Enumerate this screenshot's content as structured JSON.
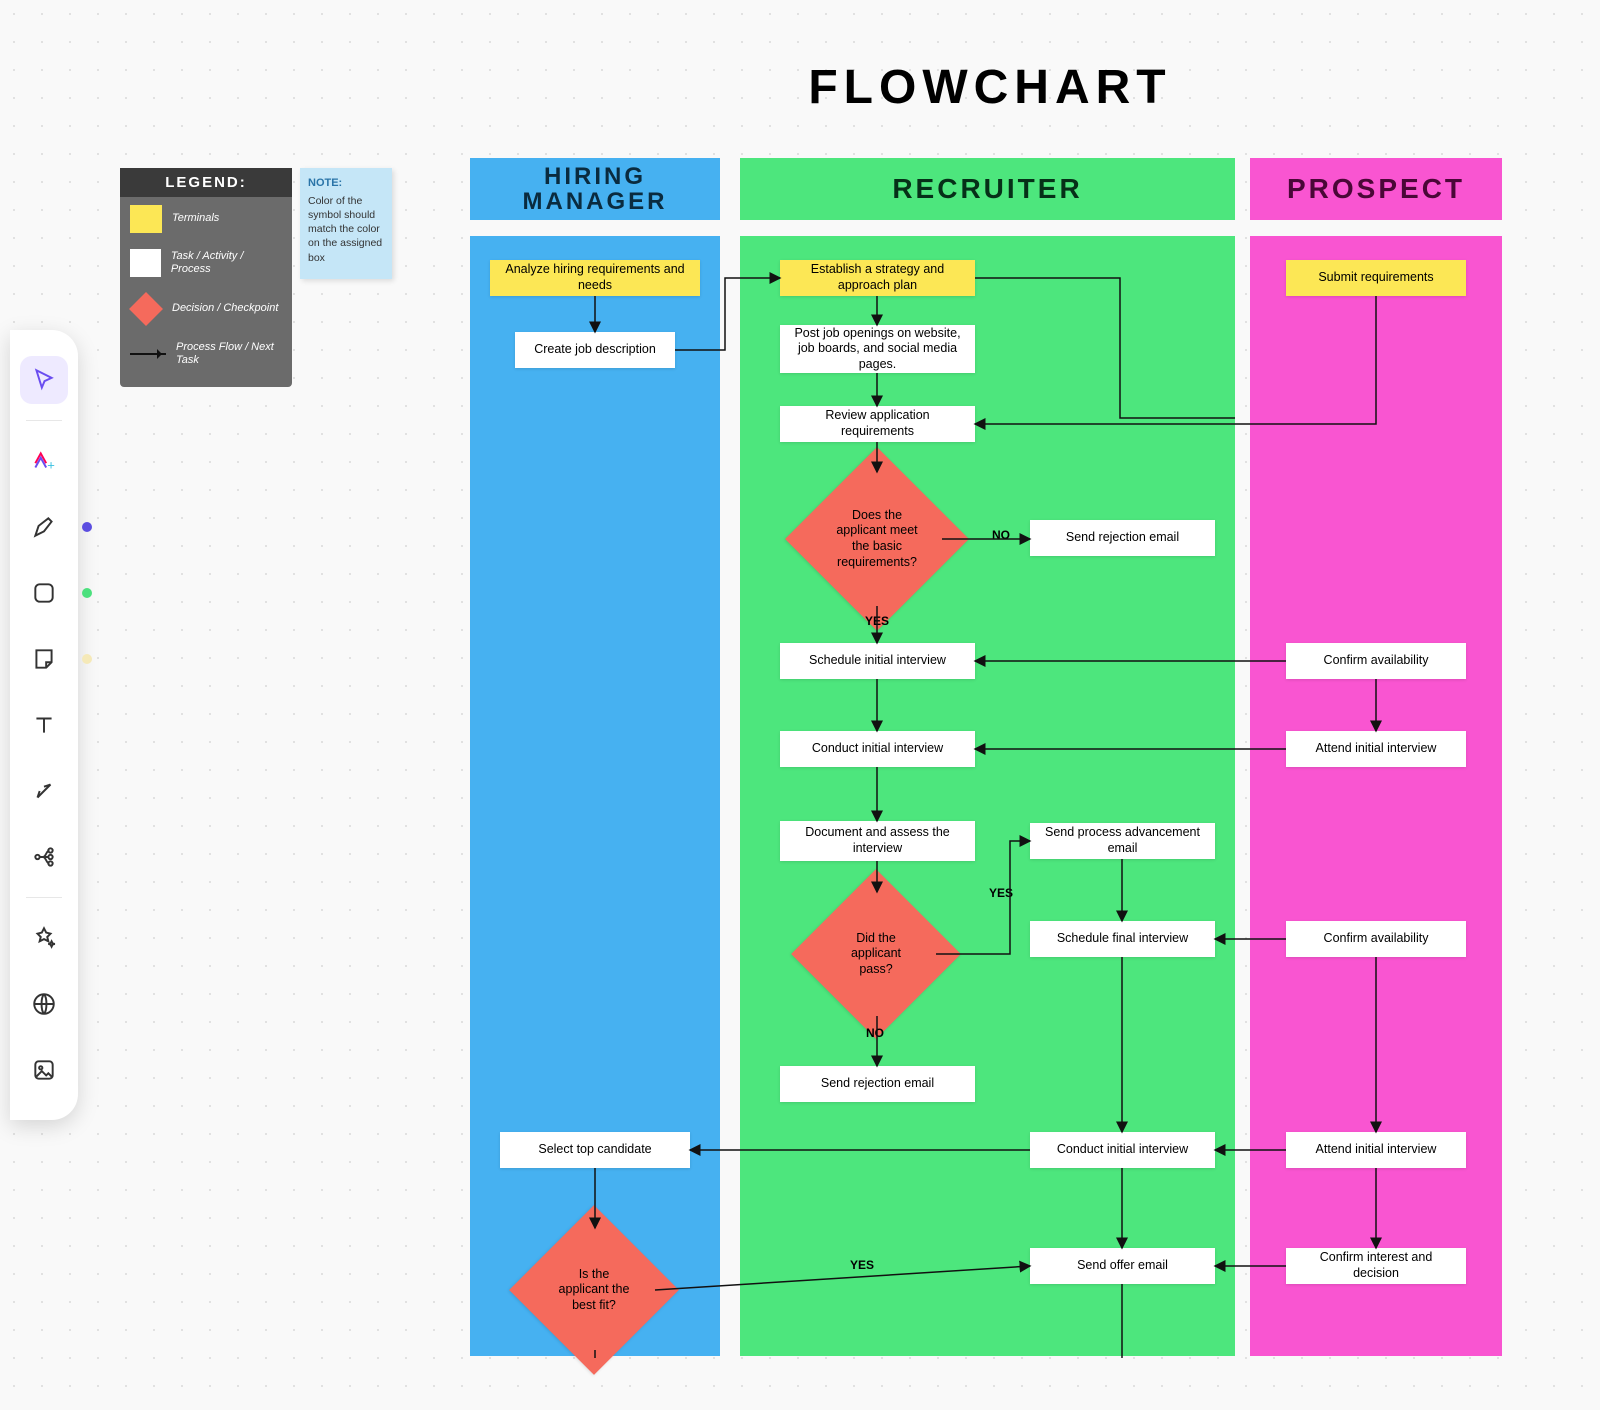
{
  "title": "FLOWCHART",
  "legend": {
    "header": "LEGEND:",
    "terminals": "Terminals",
    "task": "Task / Activity / Process",
    "decision": "Decision / Checkpoint",
    "flow": "Process Flow / Next Task"
  },
  "note": {
    "header": "NOTE:",
    "body": "Color of the symbol should match the color on the assigned box"
  },
  "lanes": {
    "manager": "HIRING\nMANAGER",
    "recruiter": "RECRUITER",
    "prospect": "PROSPECT"
  },
  "nodes": {
    "m_analyze": "Analyze hiring requirements and needs",
    "m_jobdesc": "Create job description",
    "m_select": "Select top candidate",
    "m_bestfit": "Is the applicant the best fit?",
    "r_strategy": "Establish a strategy and approach plan",
    "r_post": "Post job openings on website, job boards, and social media pages.",
    "r_reviewreq": "Review application requirements",
    "r_meetsreq": "Does the applicant meet the basic requirements?",
    "r_rejection1": "Send rejection email",
    "r_schedule1": "Schedule initial interview",
    "r_conduct1": "Conduct initial interview",
    "r_document": "Document and assess the interview",
    "r_pass": "Did the applicant pass?",
    "r_rejection2": "Send rejection email",
    "r_advance": "Send process advancement email",
    "r_schedulef": "Schedule final interview",
    "r_conduct2": "Conduct initial interview",
    "r_offer": "Send offer email",
    "p_submit": "Submit requirements",
    "p_conf1": "Confirm availability",
    "p_attend1": "Attend initial interview",
    "p_conf2": "Confirm availability",
    "p_attend2": "Attend initial interview",
    "p_interest": "Confirm interest and decision"
  },
  "labels": {
    "yes": "YES",
    "no": "NO"
  },
  "colors": {
    "blue": "#46b1f1",
    "green": "#4de67d",
    "pink": "#f955d1",
    "yellow": "#fce755",
    "salmon": "#f56a5c"
  },
  "chart_data": {
    "type": "swimlane-flowchart",
    "lanes": [
      "Hiring Manager",
      "Recruiter",
      "Prospect"
    ],
    "nodes": [
      {
        "id": "m_analyze",
        "lane": "Hiring Manager",
        "kind": "terminal",
        "label": "Analyze hiring requirements and needs"
      },
      {
        "id": "m_jobdesc",
        "lane": "Hiring Manager",
        "kind": "process",
        "label": "Create job description"
      },
      {
        "id": "m_select",
        "lane": "Hiring Manager",
        "kind": "process",
        "label": "Select top candidate"
      },
      {
        "id": "m_bestfit",
        "lane": "Hiring Manager",
        "kind": "decision",
        "label": "Is the applicant the best fit?"
      },
      {
        "id": "r_strategy",
        "lane": "Recruiter",
        "kind": "terminal",
        "label": "Establish a strategy and approach plan"
      },
      {
        "id": "r_post",
        "lane": "Recruiter",
        "kind": "process",
        "label": "Post job openings on website, job boards, and social media pages."
      },
      {
        "id": "r_reviewreq",
        "lane": "Recruiter",
        "kind": "process",
        "label": "Review application requirements"
      },
      {
        "id": "r_meetsreq",
        "lane": "Recruiter",
        "kind": "decision",
        "label": "Does the applicant meet the basic requirements?"
      },
      {
        "id": "r_rejection1",
        "lane": "Recruiter",
        "kind": "process",
        "label": "Send rejection email"
      },
      {
        "id": "r_schedule1",
        "lane": "Recruiter",
        "kind": "process",
        "label": "Schedule initial interview"
      },
      {
        "id": "r_conduct1",
        "lane": "Recruiter",
        "kind": "process",
        "label": "Conduct initial interview"
      },
      {
        "id": "r_document",
        "lane": "Recruiter",
        "kind": "process",
        "label": "Document and assess the interview"
      },
      {
        "id": "r_pass",
        "lane": "Recruiter",
        "kind": "decision",
        "label": "Did the applicant pass?"
      },
      {
        "id": "r_rejection2",
        "lane": "Recruiter",
        "kind": "process",
        "label": "Send rejection email"
      },
      {
        "id": "r_advance",
        "lane": "Recruiter",
        "kind": "process",
        "label": "Send process advancement email"
      },
      {
        "id": "r_schedulef",
        "lane": "Recruiter",
        "kind": "process",
        "label": "Schedule final interview"
      },
      {
        "id": "r_conduct2",
        "lane": "Recruiter",
        "kind": "process",
        "label": "Conduct initial interview"
      },
      {
        "id": "r_offer",
        "lane": "Recruiter",
        "kind": "process",
        "label": "Send offer email"
      },
      {
        "id": "p_submit",
        "lane": "Prospect",
        "kind": "terminal",
        "label": "Submit requirements"
      },
      {
        "id": "p_conf1",
        "lane": "Prospect",
        "kind": "process",
        "label": "Confirm availability"
      },
      {
        "id": "p_attend1",
        "lane": "Prospect",
        "kind": "process",
        "label": "Attend initial interview"
      },
      {
        "id": "p_conf2",
        "lane": "Prospect",
        "kind": "process",
        "label": "Confirm availability"
      },
      {
        "id": "p_attend2",
        "lane": "Prospect",
        "kind": "process",
        "label": "Attend initial interview"
      },
      {
        "id": "p_interest",
        "lane": "Prospect",
        "kind": "process",
        "label": "Confirm interest and decision"
      }
    ],
    "edges": [
      {
        "from": "m_analyze",
        "to": "m_jobdesc"
      },
      {
        "from": "m_jobdesc",
        "to": "r_strategy"
      },
      {
        "from": "r_strategy",
        "to": "r_post"
      },
      {
        "from": "r_strategy",
        "to": "p_submit"
      },
      {
        "from": "r_post",
        "to": "r_reviewreq"
      },
      {
        "from": "p_submit",
        "to": "r_reviewreq"
      },
      {
        "from": "r_reviewreq",
        "to": "r_meetsreq"
      },
      {
        "from": "r_meetsreq",
        "to": "r_rejection1",
        "label": "NO"
      },
      {
        "from": "r_meetsreq",
        "to": "r_schedule1",
        "label": "YES"
      },
      {
        "from": "r_schedule1",
        "to": "r_conduct1"
      },
      {
        "from": "p_conf1",
        "to": "r_schedule1"
      },
      {
        "from": "p_conf1",
        "to": "p_attend1"
      },
      {
        "from": "p_attend1",
        "to": "r_conduct1"
      },
      {
        "from": "r_conduct1",
        "to": "r_document"
      },
      {
        "from": "r_document",
        "to": "r_pass"
      },
      {
        "from": "r_pass",
        "to": "r_rejection2",
        "label": "NO"
      },
      {
        "from": "r_pass",
        "to": "r_advance",
        "label": "YES"
      },
      {
        "from": "r_advance",
        "to": "r_schedulef"
      },
      {
        "from": "p_conf2",
        "to": "r_schedulef"
      },
      {
        "from": "r_schedulef",
        "to": "r_conduct2"
      },
      {
        "from": "p_conf2",
        "to": "p_attend2"
      },
      {
        "from": "p_attend2",
        "to": "r_conduct2"
      },
      {
        "from": "r_conduct2",
        "to": "m_select"
      },
      {
        "from": "m_select",
        "to": "m_bestfit"
      },
      {
        "from": "m_bestfit",
        "to": "r_offer",
        "label": "YES"
      },
      {
        "from": "p_interest",
        "to": "r_offer"
      },
      {
        "from": "p_attend2",
        "to": "p_interest"
      }
    ]
  }
}
